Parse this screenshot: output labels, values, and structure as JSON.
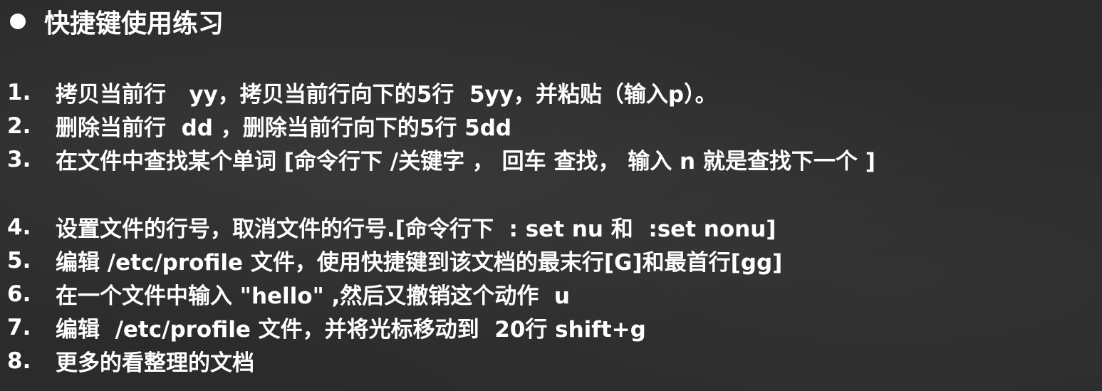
{
  "slide": {
    "title": "快捷键使用练习",
    "items": [
      {
        "num": "1.",
        "text": "拷贝当前行   yy，拷贝当前行向下的5行  5yy，并粘贴（输入p）。"
      },
      {
        "num": "2.",
        "text": "删除当前行  dd ，删除当前行向下的5行 5dd"
      },
      {
        "num": "3.",
        "text": "在文件中查找某个单词 [命令行下 /关键字 ， 回车 查找， 输入 n 就是查找下一个 ]"
      },
      {
        "num": "4.",
        "text": "设置文件的行号，取消文件的行号.[命令行下  : set nu 和  :set nonu]"
      },
      {
        "num": "5.",
        "text": "编辑 /etc/profile 文件，使用快捷键到该文档的最末行[G]和最首行[gg]"
      },
      {
        "num": "6.",
        "text": "在一个文件中输入 \"hello\" ,然后又撤销这个动作  u"
      },
      {
        "num": "7.",
        "text": "编辑  /etc/profile 文件，并将光标移动到  20行 shift+g"
      },
      {
        "num": "8.",
        "text": "更多的看整理的文档"
      }
    ]
  }
}
